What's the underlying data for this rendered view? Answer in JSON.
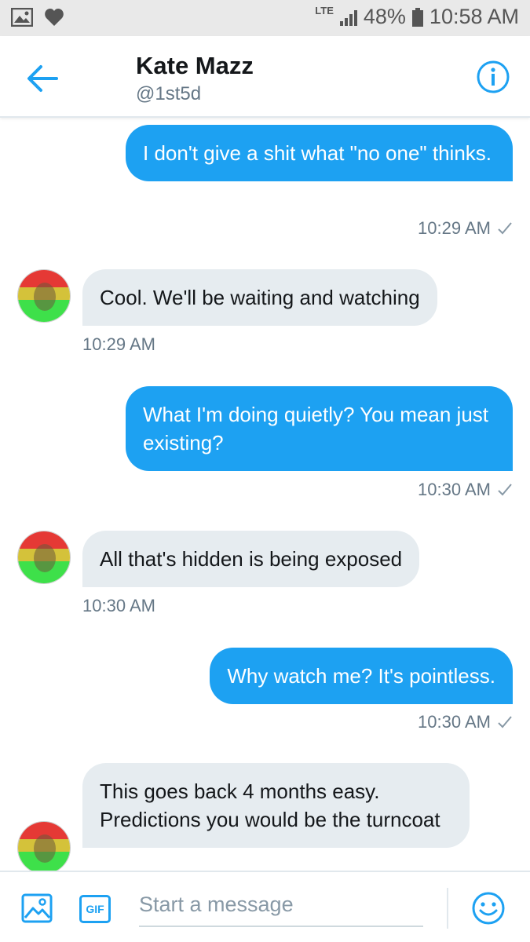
{
  "status_bar": {
    "network": "LTE",
    "battery": "48%",
    "time": "10:58 AM"
  },
  "header": {
    "name": "Kate Mazz",
    "handle": "@1st5d"
  },
  "messages": [
    {
      "direction": "outgoing",
      "text": "I don't give a shit what \"no one\" thinks.",
      "time": "10:29 AM",
      "read": true
    },
    {
      "direction": "incoming",
      "text": "Cool.  We'll be waiting and watching",
      "time": "10:29 AM"
    },
    {
      "direction": "outgoing",
      "text": "What I'm doing quietly? You mean just existing?",
      "time": "10:30 AM",
      "read": true
    },
    {
      "direction": "incoming",
      "text": "All that's hidden is being exposed",
      "time": "10:30 AM"
    },
    {
      "direction": "outgoing",
      "text": "Why watch me? It's pointless.",
      "time": "10:30 AM",
      "read": true
    },
    {
      "direction": "incoming",
      "text": "This goes back 4 months easy. Predictions you would be the turncoat",
      "time": ""
    }
  ],
  "composer": {
    "placeholder": "Start a message",
    "gif_label": "GIF"
  },
  "colors": {
    "accent": "#1da1f2",
    "incoming_bubble": "#e6ecf0",
    "muted_text": "#657786"
  }
}
